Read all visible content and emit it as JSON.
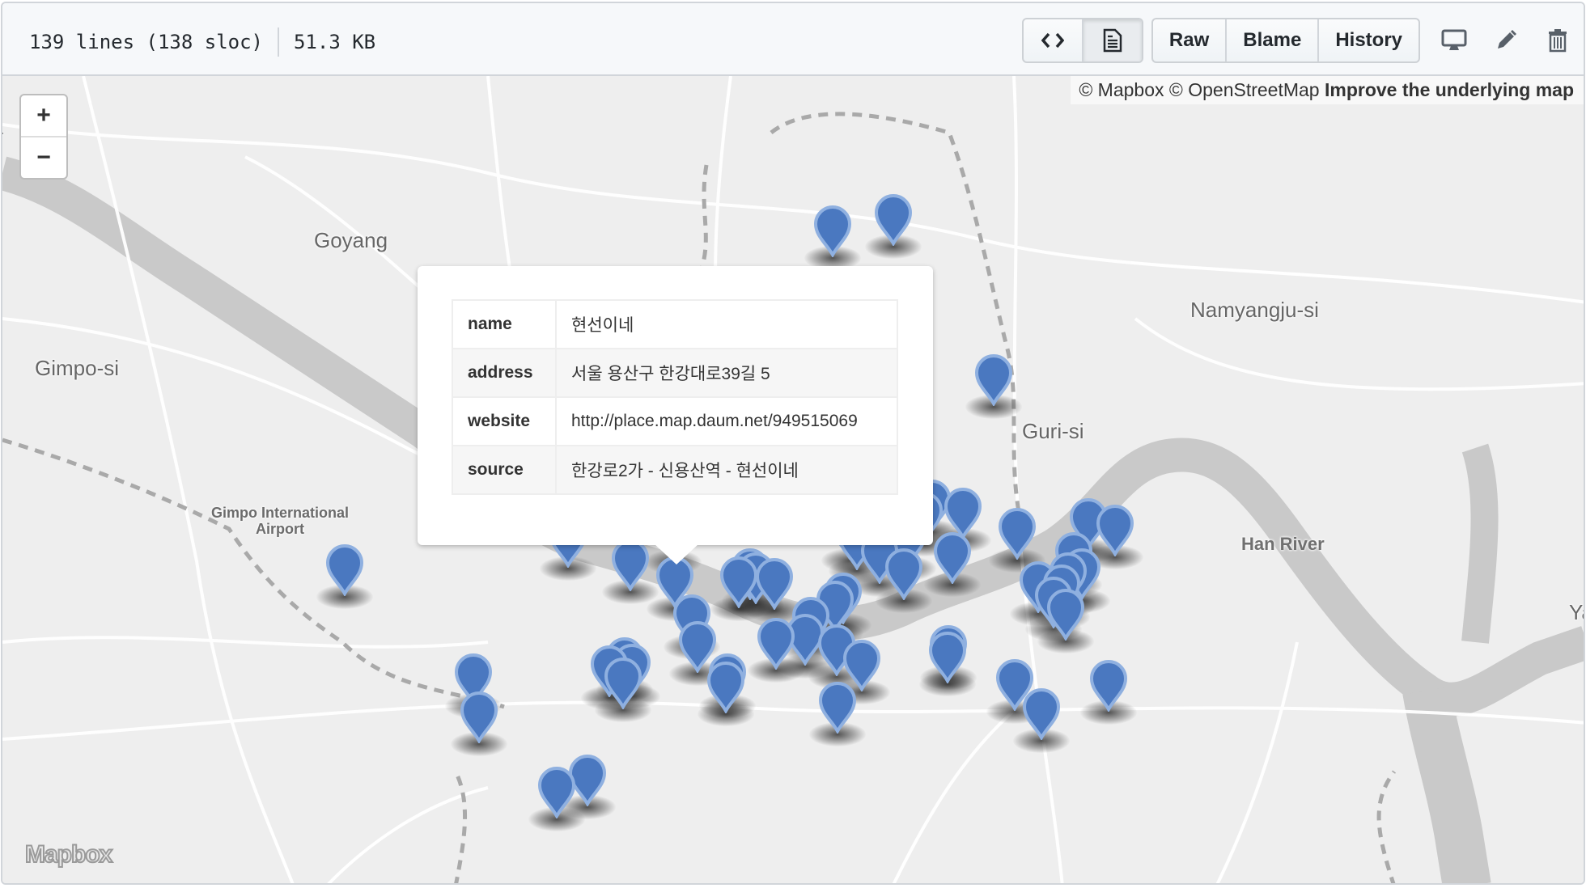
{
  "file_header": {
    "lines": "139 lines (138 sloc)",
    "size": "51.3 KB",
    "view_toggle": [
      {
        "icon": "code-icon",
        "label": "Display the source blob",
        "selected": false
      },
      {
        "icon": "file-icon",
        "label": "Display the rendered blob",
        "selected": true
      }
    ],
    "buttons": [
      "Raw",
      "Blame",
      "History"
    ],
    "tools": [
      "desktop-icon",
      "pencil-icon",
      "trash-icon"
    ]
  },
  "map": {
    "zoom_in": "+",
    "zoom_out": "−",
    "attribution": {
      "mapbox": "© Mapbox",
      "osm": "© OpenStreetMap",
      "improve": "Improve the underlying map"
    },
    "logo": "Mapbox",
    "labels": {
      "goyang": "Goyang",
      "gimpo": "Gimpo-si",
      "airport_line1": "Gimpo International",
      "airport_line2": "Airport",
      "namyangju": "Namyangju-si",
      "guri": "Guri-si",
      "han_river": "Han River",
      "edge_left": "r",
      "edge_right": "Ya"
    },
    "marker_colors": {
      "fill": "#4a78c0",
      "stroke": "#8fb0e0"
    },
    "marker_count_visible": 56,
    "popup": {
      "rows": [
        {
          "key": "name",
          "value": "현선이네"
        },
        {
          "key": "address",
          "value": "서울 용산구 한강대로39길 5"
        },
        {
          "key": "website",
          "value": "http://place.map.daum.net/949515069"
        },
        {
          "key": "source",
          "value": "한강로2가 - 신용산역 - 현선이네"
        }
      ]
    }
  }
}
